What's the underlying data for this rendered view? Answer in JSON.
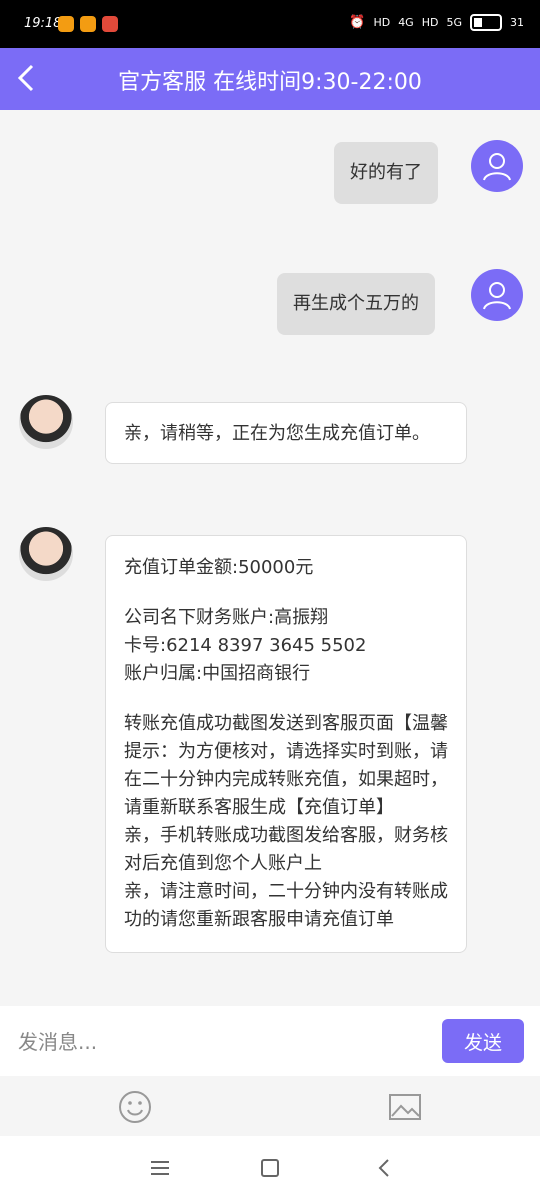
{
  "status_bar": {
    "time": "19:18",
    "battery": "31",
    "signal_labels": [
      "HD",
      "4G",
      "HD",
      "5G"
    ]
  },
  "header": {
    "back_icon": "chevron-left-icon",
    "title": "官方客服 在线时间9:30-22:00"
  },
  "messages": [
    {
      "from": "user",
      "text": "好的有了"
    },
    {
      "from": "user",
      "text": "再生成个五万的"
    },
    {
      "from": "agent",
      "text": "亲，请稍等，正在为您生成充值订单。"
    },
    {
      "from": "agent",
      "lines": {
        "amount": "充值订单金额:50000元",
        "account_name": "公司名下财务账户:高振翔",
        "card": "卡号:6214 8397 3645 5502",
        "bank": "账户归属:中国招商银行",
        "notice_1": "转账充值成功截图发送到客服页面【温馨提示：为方便核对，请选择实时到账，请在二十分钟内完成转账充值，如果超时，请重新联系客服生成【充值订单】",
        "notice_2": "亲，手机转账成功截图发给客服，财务核对后充值到您个人账户上",
        "notice_3": "亲，请注意时间，二十分钟内没有转账成功的请您重新跟客服申请充值订单"
      }
    }
  ],
  "input": {
    "placeholder": "发消息...",
    "send_label": "发送"
  },
  "toolbar": {
    "icons": [
      "emoji-icon",
      "image-icon"
    ]
  },
  "navigation": {
    "icons": [
      "menu-icon",
      "home-icon",
      "back-icon"
    ]
  },
  "colors": {
    "accent": "#7b6cf6",
    "chat_bg": "#f5f5f5",
    "user_bubble": "#dedede"
  }
}
